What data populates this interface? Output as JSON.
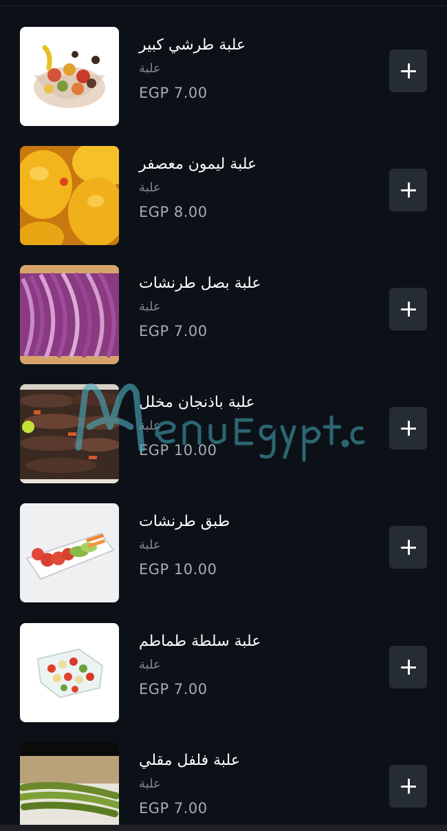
{
  "menu": {
    "items": [
      {
        "name": "علبة طرشي كبير",
        "unit": "علبة",
        "price": "EGP 7.00",
        "image": "mixed-pickles-bowl",
        "add_icon": "plus-icon"
      },
      {
        "name": "علبة ليمون معصفر",
        "unit": "علبة",
        "price": "EGP 8.00",
        "image": "pickled-lemons",
        "add_icon": "plus-icon"
      },
      {
        "name": "علبة بصل طرنشات",
        "unit": "علبة",
        "price": "EGP 7.00",
        "image": "red-onion-slices",
        "add_icon": "plus-icon"
      },
      {
        "name": "علبة باذنجان مخلل",
        "unit": "علبة",
        "price": "EGP 10.00",
        "image": "pickled-eggplant",
        "add_icon": "plus-icon"
      },
      {
        "name": "طبق طرنشات",
        "unit": "علبة",
        "price": "EGP 10.00",
        "image": "vegetable-plate",
        "add_icon": "plus-icon"
      },
      {
        "name": "علبة سلطة طماطم",
        "unit": "علبة",
        "price": "EGP 7.00",
        "image": "tomato-salad-box",
        "add_icon": "plus-icon"
      },
      {
        "name": "علبة فلفل مقلي",
        "unit": "علبة",
        "price": "EGP 7.00",
        "image": "fried-peppers",
        "add_icon": "plus-icon"
      }
    ]
  },
  "watermark": {
    "text": "MenuEgypt.com"
  },
  "colors": {
    "background": "#0c1118",
    "button": "#262c33",
    "price": "#a7acb2",
    "unit": "#7f858d",
    "watermark": "#4aa6b8"
  }
}
